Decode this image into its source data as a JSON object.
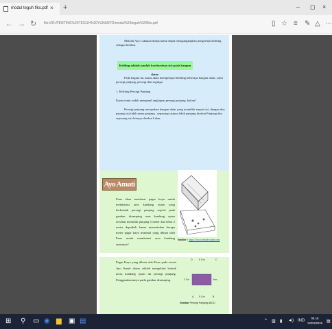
{
  "browser": {
    "tab_title": "modul teguh fiks.pdf",
    "tab_close": "×",
    "new_tab": "+",
    "win_min": "–",
    "win_max": "◻",
    "win_close": "×",
    "url": "file:///D:/PENTING%20TEGUH%20YUNANTO/modul%20teguh%20fiks.pdf",
    "zoom": ""
  },
  "doc": {
    "blue_p1": "Melalui Ayo Lakukan diatas kamu dapat mengungkapkan pengertian keliling sebagai berikut.",
    "highlight": "Keliling adalah jumlah keseluruhan sisi pada bangun datar.",
    "blue_p2": "Pada bagian ini, kamu akan mempelajari keliling beberapa bangun datar, yaitu persegi panjang, persegi dan segitiga.",
    "item1": "1. Keliling Persegi Panjang",
    "blue_p3": "Kamu tentu sudah mengenal ungkapan persegi panjang, bukan?",
    "blue_p4": "Persegi panjang merupakan bangun datar yang memiliki empat sisi, dengan dua pasang sisi tidak sama panjang , sepasang sisinya lebih panjang disebut Panjang dan sepasang sisi lainnya disebut Lebar.",
    "ayo_title": "Ayo Amati",
    "green_p1": "Fano akan membuat pagar kayu untuk membatasi area kandang ayam yang berbentuk persegi panjang seperti pada gambar disamping area kandang ayam tersebut memiliki panjang 5 meter dan lebar 2 meter dapatkah kamu menentukan berapa meter pagar kayu minimal yang dibuat oleh Fano untuk membatasi area kandang ayamnya?",
    "illus_caption_prefix": "Sumber :",
    "illus_caption_link": "https://www.tentak-soam.com",
    "green_p2": "Pagar Kayu yang dibuat oleh Fano pada sesuai Ayo Amati diatas adalah mengeliuti bentuk areas kandang ayam itu persegi panjang. Penggambarannya pada gambar disamping.",
    "rect_labels": {
      "top_left": "D",
      "top_mid": "5 Cm",
      "top_right": "C",
      "left": "2 Cm",
      "right": "2cm",
      "bottom_left": "A",
      "bottom_mid": "5 Cm",
      "bottom_right": "B"
    },
    "rect_caption_bold": "Gambar",
    "rect_caption": "Persegi Panjang ABCD"
  },
  "taskbar": {
    "time": "06.16",
    "date": "12/04/2019",
    "lang": "IND"
  },
  "colors": {
    "blue_section": "#d6ecfb",
    "green_section": "#dff7d1",
    "highlight": "#9ef59a",
    "rectangle_fill": "#8b5ba8",
    "taskbar": "#1c2336"
  }
}
